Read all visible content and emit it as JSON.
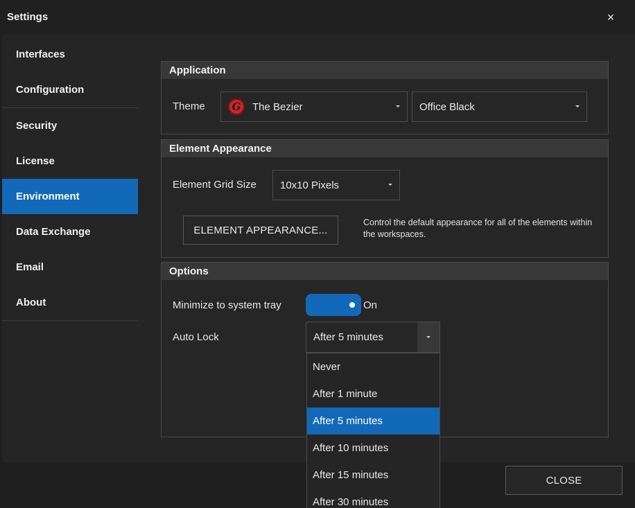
{
  "window": {
    "title": "Settings",
    "close_glyph": "×"
  },
  "sidebar": {
    "items": [
      {
        "label": "Interfaces",
        "active": false
      },
      {
        "label": "Configuration",
        "active": false
      },
      {
        "label": "Security",
        "active": false
      },
      {
        "label": "License",
        "active": false
      },
      {
        "label": "Environment",
        "active": true
      },
      {
        "label": "Data Exchange",
        "active": false
      },
      {
        "label": "Email",
        "active": false
      },
      {
        "label": "About",
        "active": false
      }
    ]
  },
  "application": {
    "header": "Application",
    "theme_label": "Theme",
    "theme_value": "The Bezier",
    "theme_icon": "bezier-logo-icon",
    "style_value": "Office Black"
  },
  "element_appearance": {
    "header": "Element Appearance",
    "grid_label": "Element Grid Size",
    "grid_value": "10x10 Pixels",
    "button_label": "ELEMENT APPEARANCE...",
    "description": "Control the default appearance for all of the elements within the workspaces."
  },
  "options": {
    "header": "Options",
    "minimize_label": "Minimize to system tray",
    "minimize_state": "On",
    "autolock_label": "Auto Lock",
    "autolock_value": "After 5 minutes",
    "autolock_options": [
      {
        "label": "Never",
        "selected": false
      },
      {
        "label": "After 1 minute",
        "selected": false
      },
      {
        "label": "After 5 minutes",
        "selected": true
      },
      {
        "label": "After 10 minutes",
        "selected": false
      },
      {
        "label": "After 15 minutes",
        "selected": false
      },
      {
        "label": "After 30 minutes",
        "selected": false
      }
    ]
  },
  "footer": {
    "close_label": "CLOSE"
  },
  "colors": {
    "accent": "#1269b8",
    "background": "#1f1f1f",
    "panel": "#252525",
    "header": "#383838"
  }
}
